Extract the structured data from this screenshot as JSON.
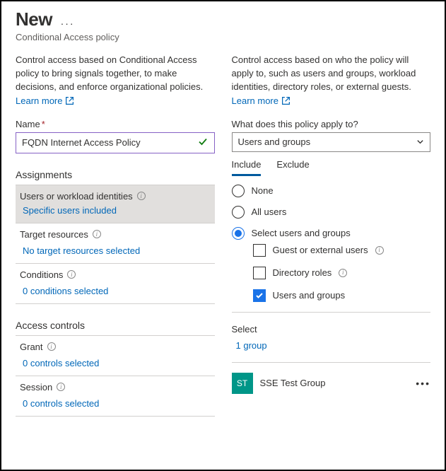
{
  "page": {
    "title": "New",
    "subtitle": "Conditional Access policy"
  },
  "left": {
    "intro": "Control access based on Conditional Access policy to bring signals together, to make decisions, and enforce organizational policies.",
    "learn_more": "Learn more",
    "name_label": "Name",
    "name_value": "FQDN Internet Access Policy",
    "section_assignments": "Assignments",
    "row_users": "Users or workload identities",
    "row_users_value": "Specific users included",
    "row_target": "Target resources",
    "row_target_value": "No target resources selected",
    "row_conditions": "Conditions",
    "row_conditions_value": "0 conditions selected",
    "section_access": "Access controls",
    "row_grant": "Grant",
    "row_grant_value": "0 controls selected",
    "row_session": "Session",
    "row_session_value": "0 controls selected"
  },
  "right": {
    "intro": "Control access based on who the policy will apply to, such as users and groups, workload identities, directory roles, or external guests.",
    "learn_more": "Learn more",
    "apply_label": "What does this policy apply to?",
    "apply_value": "Users and groups",
    "tab_include": "Include",
    "tab_exclude": "Exclude",
    "opt_none": "None",
    "opt_all": "All users",
    "opt_select": "Select users and groups",
    "chk_guest": "Guest or external users",
    "chk_roles": "Directory roles",
    "chk_groups": "Users and groups",
    "select_label": "Select",
    "select_value": "1 group",
    "group_initials": "ST",
    "group_name": "SSE Test Group"
  }
}
